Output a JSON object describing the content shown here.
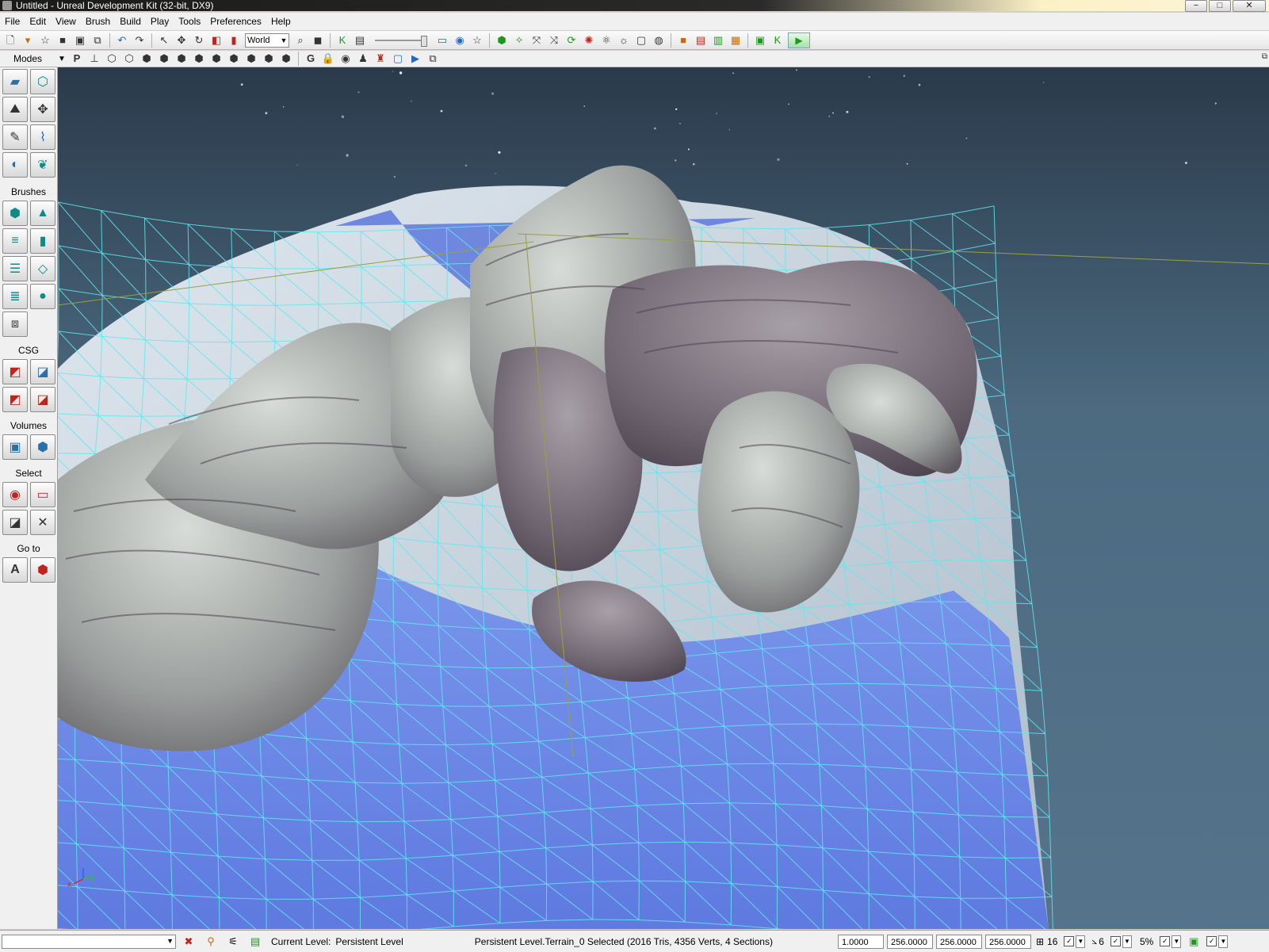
{
  "window": {
    "title": "Untitled - Unreal Development Kit (32-bit, DX9)",
    "minimize": "−",
    "maximize": "□",
    "close": "✕"
  },
  "menu": [
    "File",
    "Edit",
    "View",
    "Brush",
    "Build",
    "Play",
    "Tools",
    "Preferences",
    "Help"
  ],
  "toolbar": {
    "coord_system": "World"
  },
  "panel": {
    "modes_label": "Modes",
    "brushes_label": "Brushes",
    "csg_label": "CSG",
    "volumes_label": "Volumes",
    "select_label": "Select",
    "goto_label": "Go to"
  },
  "viewport": {
    "axis_x": "x",
    "axis_y": "Y",
    "axis_z": "Z"
  },
  "status": {
    "current_level_label": "Current Level:",
    "current_level_value": "Persistent Level",
    "selection": "Persistent Level.Terrain_0 Selected (2016 Tris, 4356 Verts, 4 Sections)",
    "drag_scale": "1.0000",
    "grid_x": "256.0000",
    "grid_y": "256.0000",
    "grid_z": "256.0000",
    "grid_size": "16",
    "rotation_snap": "6",
    "scale_snap": "5%"
  },
  "colors": {
    "wire": "#5fe8f0",
    "terrain": "#6a86e8",
    "sky": "#3e5a70"
  }
}
